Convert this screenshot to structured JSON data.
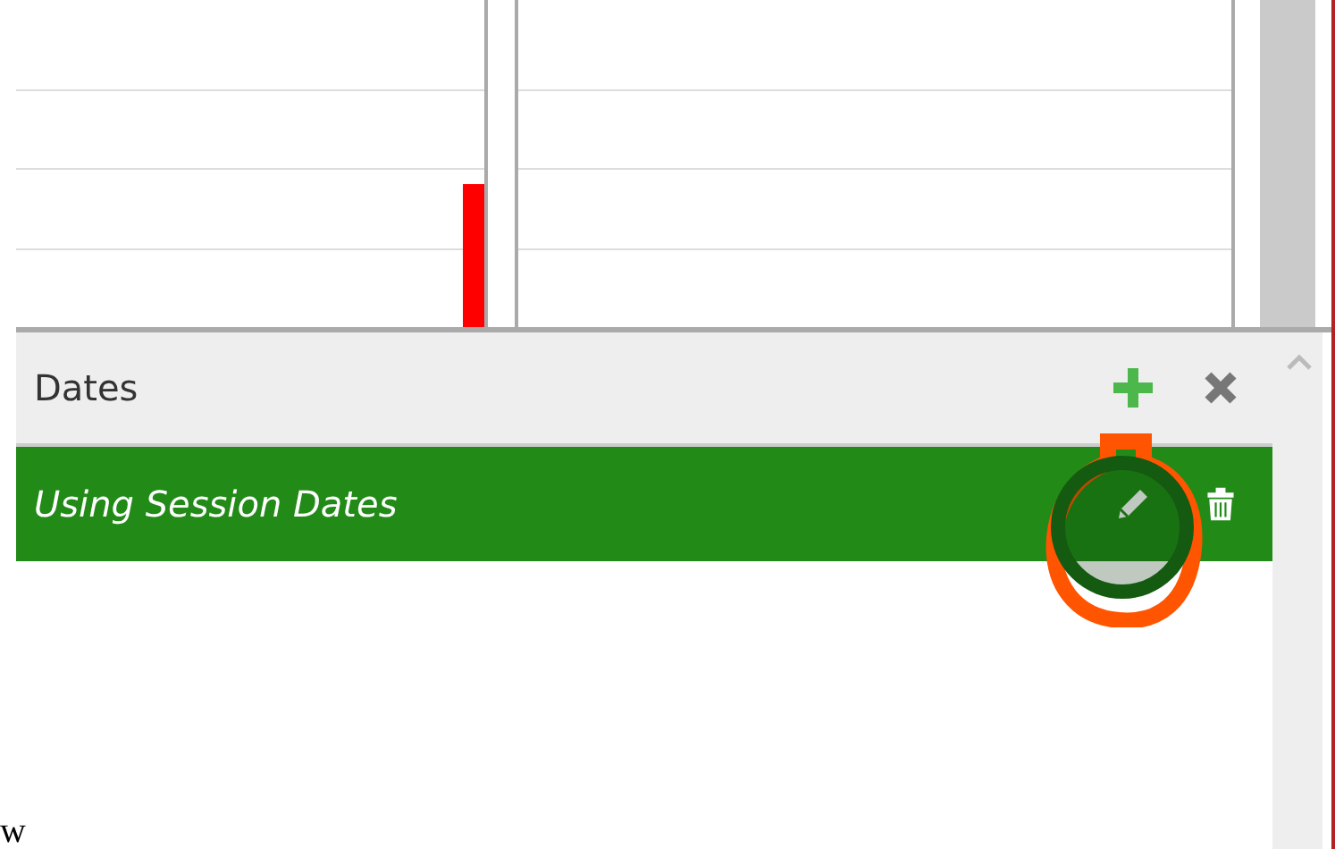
{
  "dates_panel": {
    "title": "Dates",
    "items": [
      {
        "label": "Using Session Dates",
        "selected": true
      }
    ]
  },
  "page_text_fragment": "w"
}
